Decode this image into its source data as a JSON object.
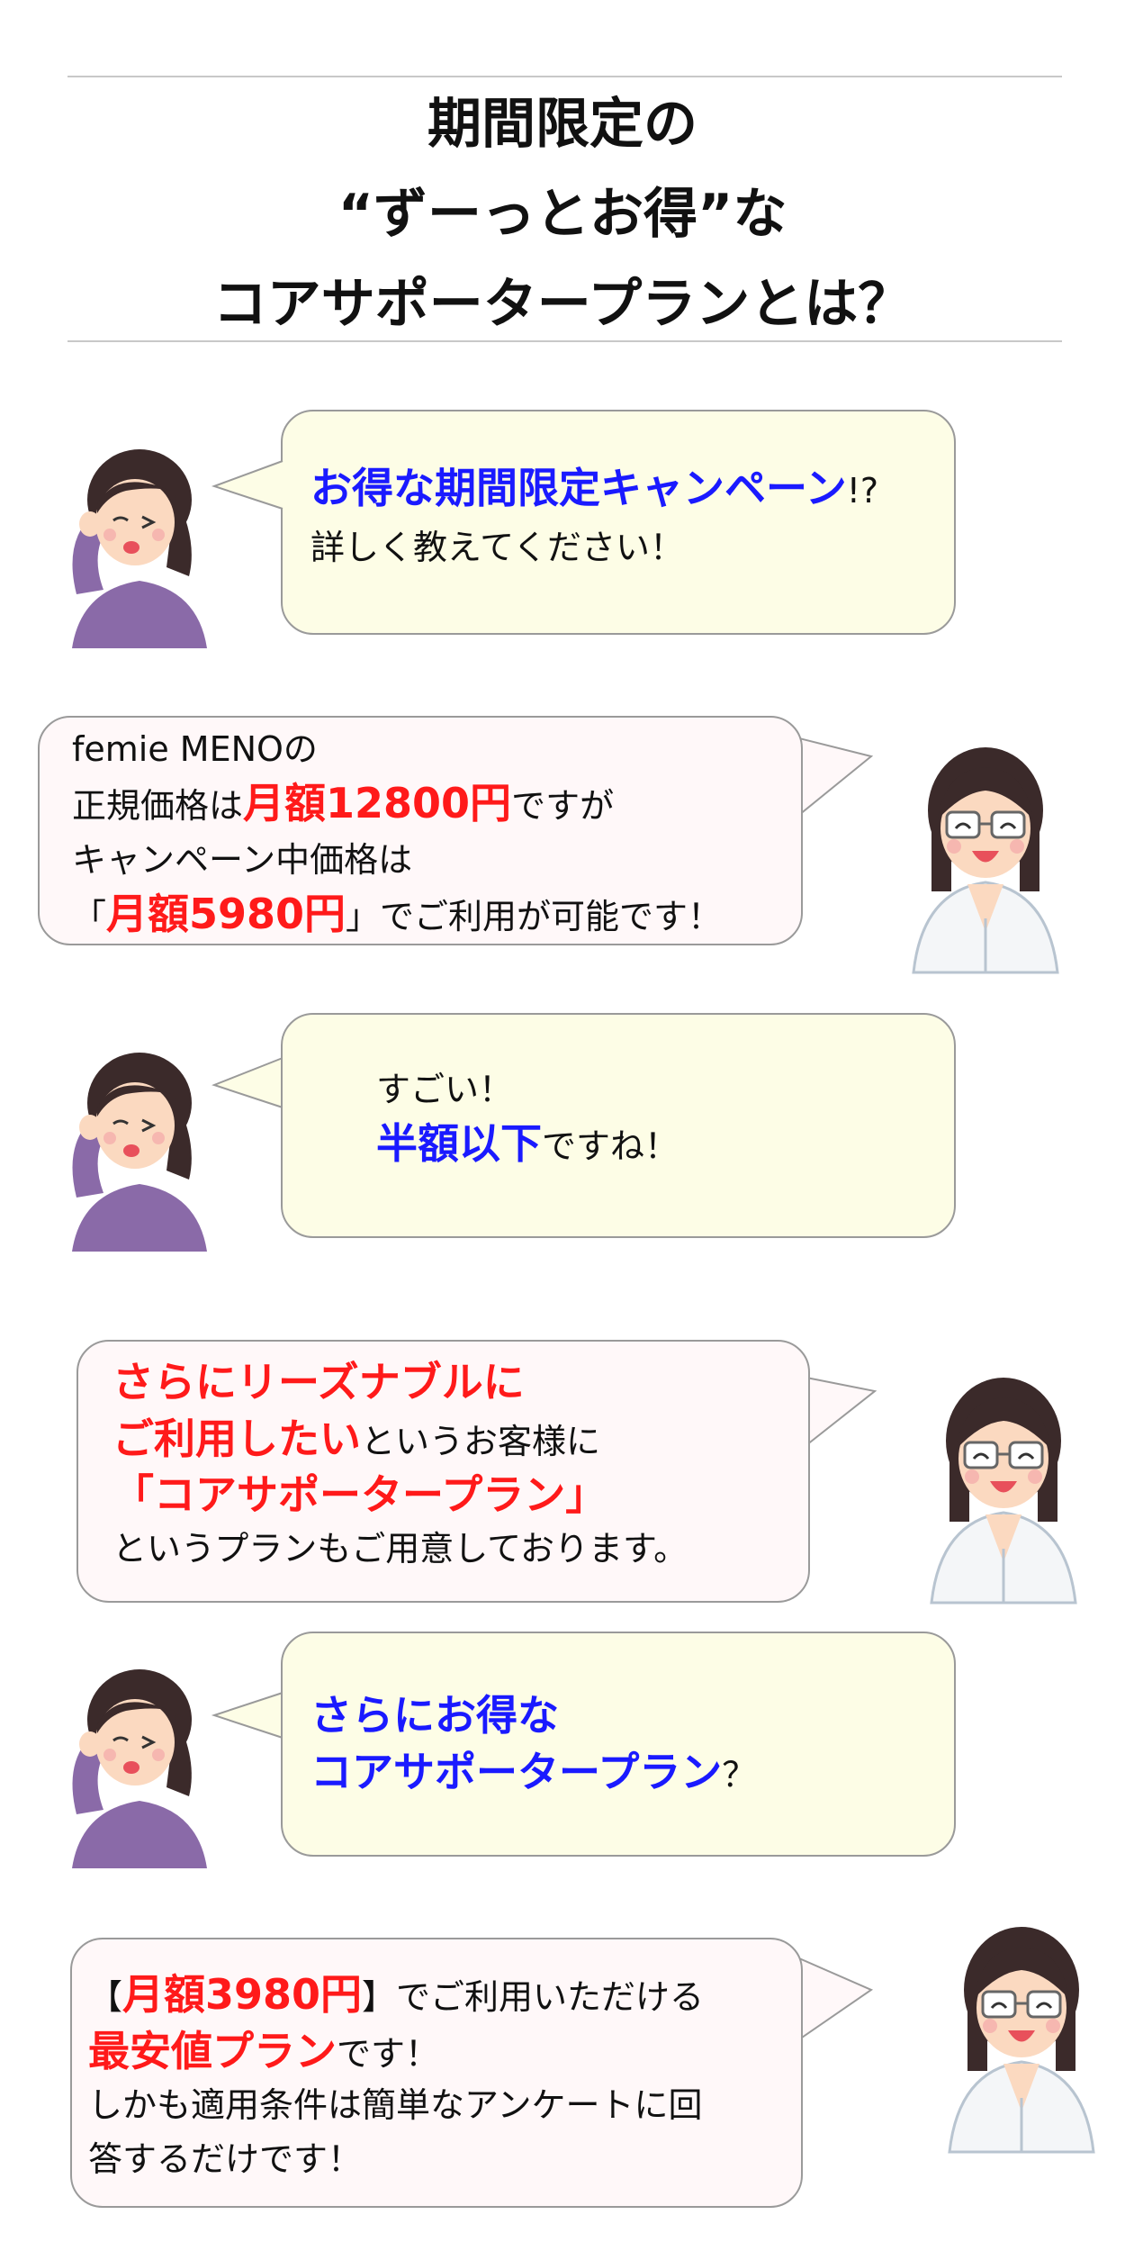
{
  "title": {
    "line1": "期間限定の",
    "line2": "“ずーっとお得”な",
    "line3": "コアサポータープランとは？"
  },
  "dialog": {
    "q1": {
      "em": "お得な期間限定キャンペーン",
      "after": "!?",
      "line2": "詳しく教えてください！"
    },
    "a1": {
      "line1": "femie MENOの",
      "line2_pre": "正規価格は",
      "line2_em": "月額12800円",
      "line2_post": "ですが",
      "line3": "キャンペーン中価格は",
      "line4_open": "「",
      "line4_em": "月額5980円",
      "line4_post": "」でご利用が可能です！"
    },
    "q2": {
      "line1": "すごい！",
      "line2_em": "半額以下",
      "line2_post": "ですね！"
    },
    "a2": {
      "line1_em": "さらにリーズナブルに",
      "line2_em": "ご利用したい",
      "line2_post": "というお客様に",
      "line3_em": "「コアサポータープラン」",
      "line4": "というプランもご用意しております。"
    },
    "q3": {
      "line1_em": "さらにお得な",
      "line2_em": "コアサポータープラン",
      "line2_post": "？"
    },
    "a3": {
      "line1_open": "【",
      "line1_em": "月額3980円",
      "line1_post": "】でご利用いただける",
      "line2_em": "最安値プラン",
      "line2_post": "です！",
      "line3": "しかも適用条件は簡単なアンケートに回",
      "line4": "答するだけです！"
    }
  },
  "colors": {
    "accent_blue": "#1a1aff",
    "accent_red": "#ff1a1a",
    "question_bubble": "#fdfde6",
    "answer_bubble": "#fff8f9"
  },
  "icons": {
    "customer": "woman-thinking-illustration",
    "doctor": "doctor-smiling-illustration"
  }
}
